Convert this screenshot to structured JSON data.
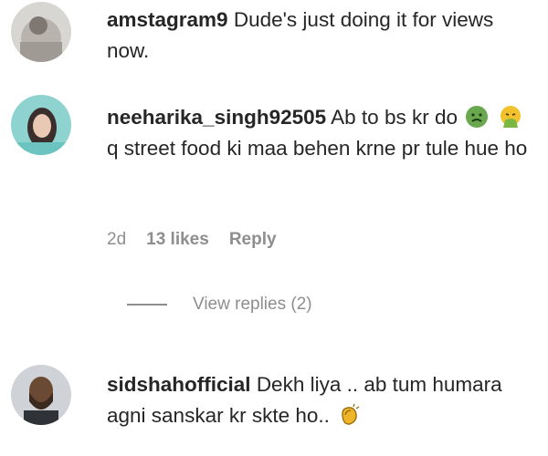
{
  "comments": [
    {
      "username": "amstagram9",
      "text": "Dude's just doing it for views now."
    },
    {
      "username": "neeharika_singh92505",
      "text_before_emoji": "Ab to bs kr do",
      "emojis": [
        "nauseated-face-icon",
        "face-vomiting-icon"
      ],
      "text_after_emoji": "q street food ki maa behen krne pr tule hue ho",
      "time": "2d",
      "likes": "13 likes",
      "reply_label": "Reply",
      "view_replies_label": "View replies (2)"
    },
    {
      "username": "sidshahofficial",
      "text": "Dekh liya .. ab tum humara agni sanskar kr skte ho..",
      "emoji": "clapping-hands-icon"
    }
  ],
  "colors": {
    "text": "#262626",
    "secondary": "#8e8e8e",
    "background": "#ffffff"
  }
}
